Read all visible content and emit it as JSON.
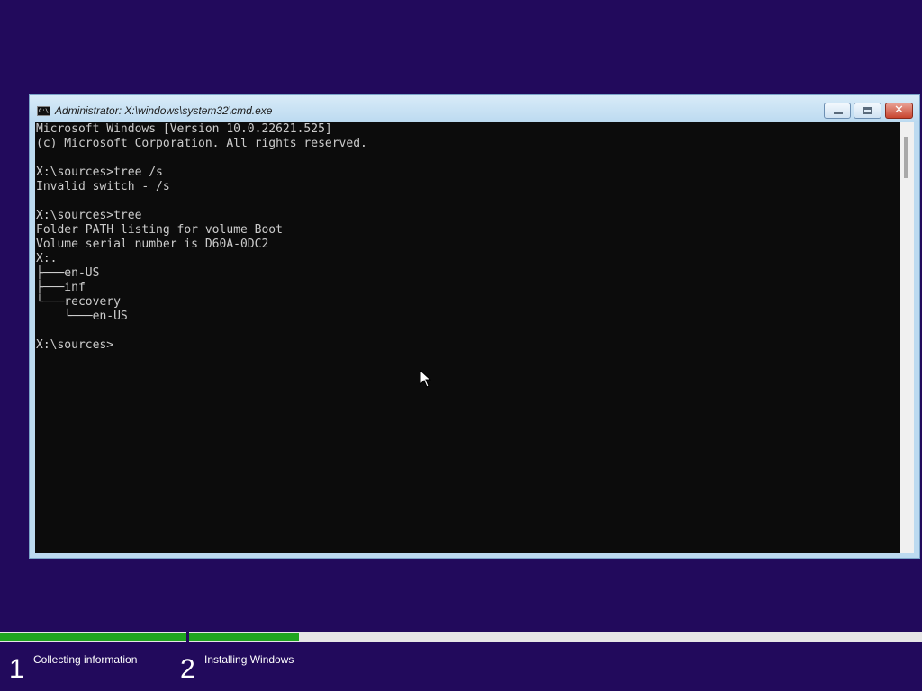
{
  "window": {
    "title": "Administrator: X:\\windows\\system32\\cmd.exe",
    "icon_label": "C:\\",
    "close_glyph": "✕"
  },
  "console": {
    "lines": [
      "Microsoft Windows [Version 10.0.22621.525]",
      "(c) Microsoft Corporation. All rights reserved.",
      "",
      "X:\\sources>tree /s",
      "Invalid switch - /s",
      "",
      "X:\\sources>tree",
      "Folder PATH listing for volume Boot",
      "Volume serial number is D60A-0DC2",
      "X:.",
      "├───en-US",
      "├───inf",
      "└───recovery",
      "    └───en-US",
      "",
      "X:\\sources>"
    ]
  },
  "setup": {
    "progress": {
      "collecting_information": 1.0,
      "installing_windows": 0.15
    },
    "steps": [
      {
        "number": "1",
        "label": "Collecting information"
      },
      {
        "number": "2",
        "label": "Installing Windows"
      }
    ]
  }
}
